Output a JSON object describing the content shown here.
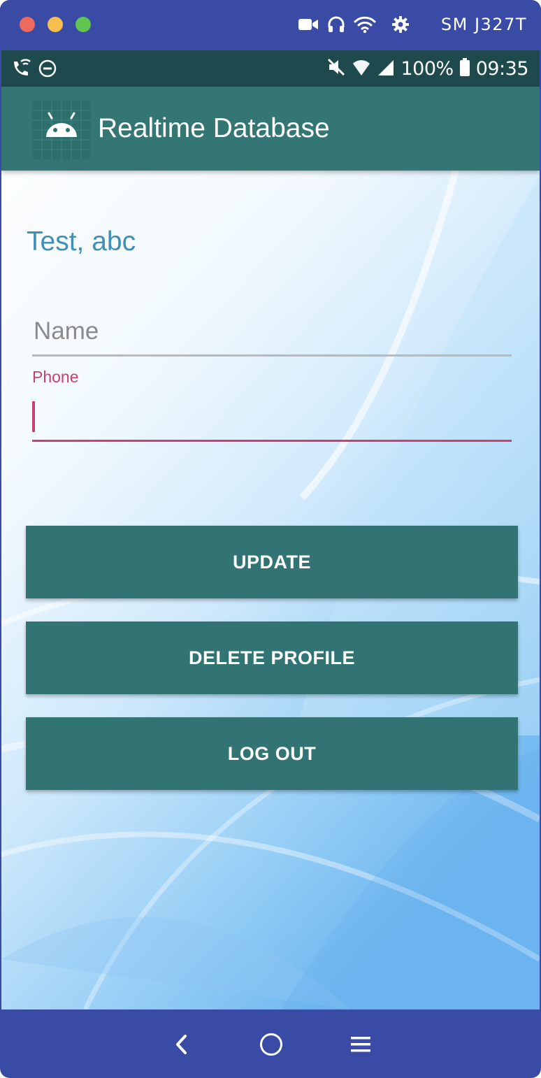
{
  "window": {
    "device_name": "SM J327T",
    "icons": [
      "video-camera-icon",
      "headphones-icon",
      "wifi-icon",
      "gear-icon"
    ],
    "traffic_lights": {
      "close": "#ed6a5e",
      "minimize": "#f5bf4f",
      "maximize": "#61c554"
    },
    "frame_color": "#3a4ba6"
  },
  "status_bar": {
    "left_icons": [
      "wifi-calling-icon",
      "do-not-disturb-icon"
    ],
    "right_icons": [
      "mute-icon",
      "wifi-signal-icon",
      "cell-signal-icon",
      "battery-icon"
    ],
    "battery": "100%",
    "time": "09:35",
    "background": "#1f4a4d"
  },
  "app_bar": {
    "title": "Realtime Database",
    "logo_icon": "android-icon",
    "background": "#337674"
  },
  "main": {
    "greeting": "Test, abc",
    "name_field": {
      "placeholder": "Name",
      "value": ""
    },
    "phone_field": {
      "label": "Phone",
      "value": ""
    },
    "buttons": {
      "update": "UPDATE",
      "delete_profile": "DELETE PROFILE",
      "log_out": "LOG OUT"
    },
    "accent_color": "#c9416e",
    "button_color": "#317473"
  },
  "nav_bar": {
    "icons": [
      "back-icon",
      "home-icon",
      "recents-icon"
    ]
  }
}
